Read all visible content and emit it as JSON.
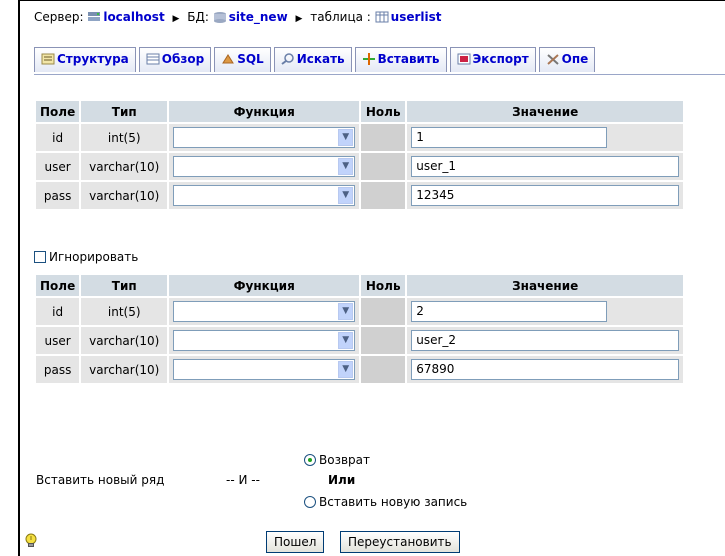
{
  "breadcrumb": {
    "server_label": "Сервер:",
    "server_value": "localhost",
    "db_label": "БД:",
    "db_value": "site_new",
    "table_label": "таблица :",
    "table_value": "userlist"
  },
  "tabs": [
    {
      "label": "Структура",
      "icon": "structure-icon"
    },
    {
      "label": "Обзор",
      "icon": "browse-icon"
    },
    {
      "label": "SQL",
      "icon": "sql-icon"
    },
    {
      "label": "Искать",
      "icon": "search-icon"
    },
    {
      "label": "Вставить",
      "icon": "insert-icon"
    },
    {
      "label": "Экспорт",
      "icon": "export-icon"
    },
    {
      "label": "Опе",
      "icon": "operations-icon"
    }
  ],
  "headers": {
    "field": "Поле",
    "type": "Тип",
    "function": "Функция",
    "null": "Ноль",
    "value": "Значение"
  },
  "rows1": [
    {
      "field": "id",
      "type": "int(5)",
      "value": "1"
    },
    {
      "field": "user",
      "type": "varchar(10)",
      "value": "user_1"
    },
    {
      "field": "pass",
      "type": "varchar(10)",
      "value": "12345"
    }
  ],
  "ignore_label": "Игнорировать",
  "rows2": [
    {
      "field": "id",
      "type": "int(5)",
      "value": "2"
    },
    {
      "field": "user",
      "type": "varchar(10)",
      "value": "user_2"
    },
    {
      "field": "pass",
      "type": "varchar(10)",
      "value": "67890"
    }
  ],
  "footer": {
    "insert_row_label": "Вставить новый ряд",
    "and_label": "-- И --",
    "return_label": "Возврат",
    "or_label": "Или",
    "insert_new_label": "Вставить новую запись",
    "go_button": "Пошел",
    "reset_button": "Переустановить"
  },
  "colors": {
    "link": "#0000cc",
    "header_bg": "#d3dce3",
    "row_bg": "#e5e5e5"
  }
}
